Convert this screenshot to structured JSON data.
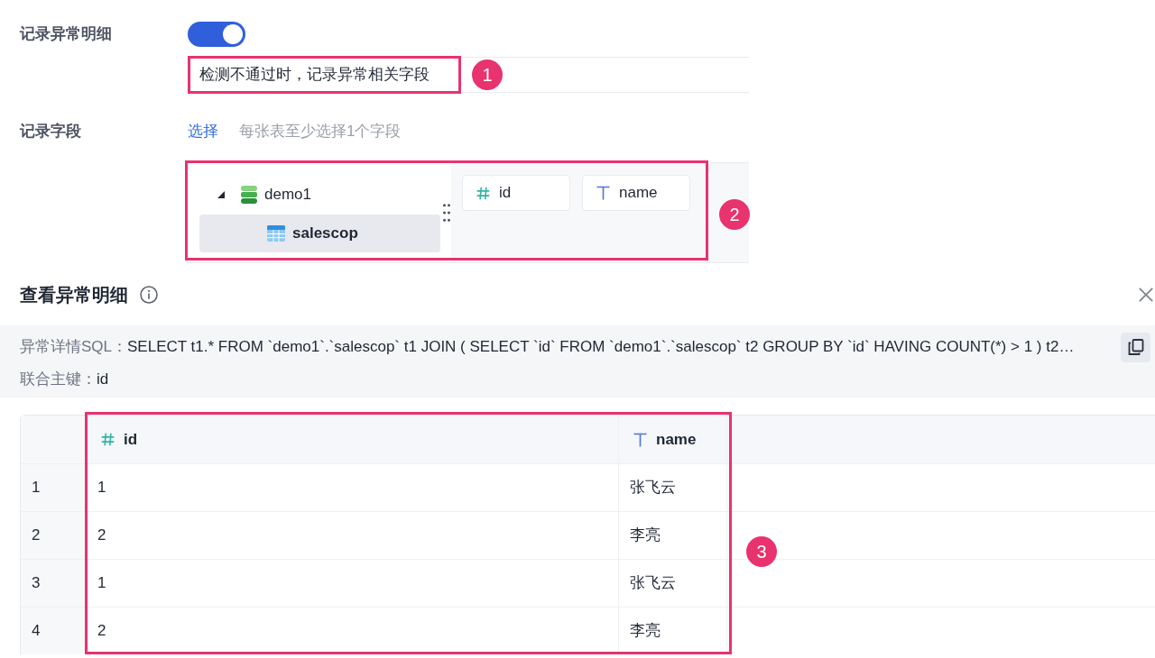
{
  "record_detail": {
    "label": "记录异常明细",
    "toggle": {
      "on": true
    },
    "description": "检测不通过时，记录异常相关字段",
    "annotation": "1"
  },
  "record_fields": {
    "label": "记录字段",
    "select_link": "选择",
    "hint": "每张表至少选择1个字段",
    "picker": {
      "annotation": "2",
      "tree": [
        {
          "label": "demo1",
          "kind": "database",
          "expanded": true,
          "selected": false,
          "children": [
            {
              "label": "salescop",
              "kind": "table",
              "selected": true
            }
          ]
        }
      ],
      "fields": [
        {
          "kind": "number",
          "name": "id"
        },
        {
          "kind": "text",
          "name": "name"
        }
      ]
    }
  },
  "detail_panel": {
    "title": "查看异常明细",
    "sql_label": "异常详情SQL：",
    "sql": "SELECT t1.* FROM `demo1`.`salescop` t1 JOIN ( SELECT `id` FROM `demo1`.`salescop` t2 GROUP BY `id` HAVING COUNT(*) > 1 ) t2…",
    "key_label": "联合主键：",
    "key_value": "id",
    "table": {
      "annotation": "3",
      "columns": [
        {
          "kind": "number",
          "name": "id"
        },
        {
          "kind": "text",
          "name": "name"
        }
      ],
      "rows": [
        {
          "number": "1",
          "cells": [
            "1",
            "张飞云"
          ]
        },
        {
          "number": "2",
          "cells": [
            "2",
            "李亮"
          ]
        },
        {
          "number": "3",
          "cells": [
            "1",
            "张飞云"
          ]
        },
        {
          "number": "4",
          "cells": [
            "2",
            "李亮"
          ]
        }
      ]
    }
  }
}
